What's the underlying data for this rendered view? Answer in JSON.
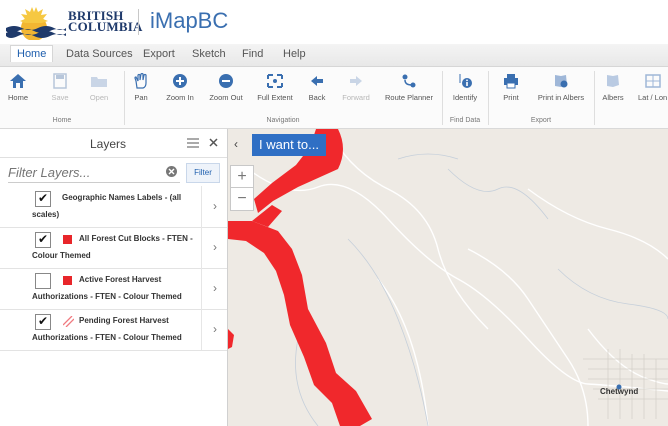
{
  "header": {
    "logo_line1": "BRITISH",
    "logo_line2": "COLUMBIA",
    "app_title": "iMapBC"
  },
  "menu_tabs": [
    "Home",
    "Data Sources",
    "Export",
    "Sketch",
    "Find",
    "Help"
  ],
  "ribbon": {
    "buttons": {
      "home": "Home",
      "save": "Save",
      "open": "Open",
      "pan": "Pan",
      "zoom_in": "Zoom In",
      "zoom_out": "Zoom Out",
      "full_extent": "Full Extent",
      "back": "Back",
      "forward": "Forward",
      "route_planner": "Route Planner",
      "identify": "Identify",
      "print": "Print",
      "print_albers": "Print in Albers",
      "albers": "Albers",
      "lat_long": "Lat / Lon"
    },
    "groups": {
      "home": "Home",
      "navigation": "Navigation",
      "find_data": "Find Data",
      "export": "Export"
    }
  },
  "layers_panel": {
    "title": "Layers",
    "filter_placeholder": "Filter Layers...",
    "filter_button": "Filter",
    "layers": [
      {
        "line1": "Geographic Names Labels - (all",
        "line2": "scales)",
        "checked": true,
        "swatch": "none"
      },
      {
        "line1": "All Forest Cut Blocks - FTEN -",
        "line2": "Colour Themed",
        "checked": true,
        "swatch": "#e8262a"
      },
      {
        "line1": "Active Forest Harvest",
        "line2": "Authorizations - FTEN - Colour Themed",
        "checked": false,
        "swatch": "#e8262a"
      },
      {
        "line1": "Pending Forest Harvest",
        "line2": "Authorizations - FTEN - Colour Themed",
        "checked": true,
        "swatch": "hatched"
      }
    ]
  },
  "map": {
    "i_want_to": "I want to...",
    "place_label": "Chetwynd",
    "colors": {
      "land": "#eeeae4",
      "cutblock": "#f0282c",
      "roads": "#ffffff",
      "accent": "#2f6fc4"
    }
  }
}
